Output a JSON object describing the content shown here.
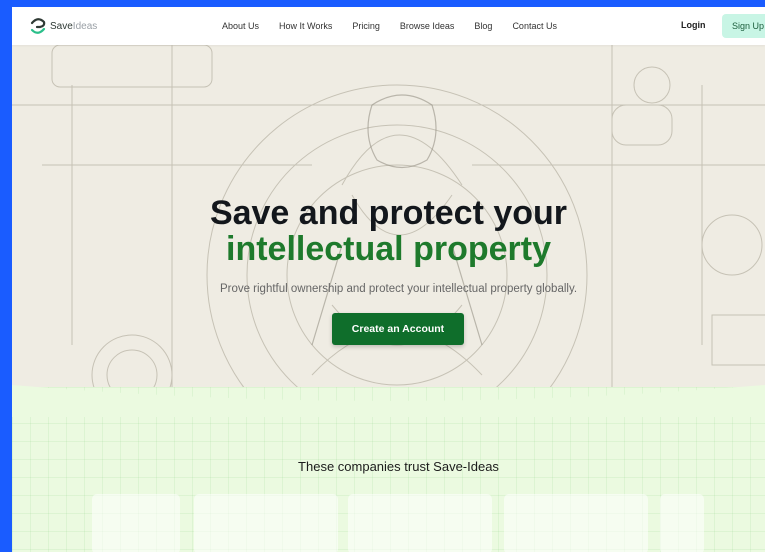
{
  "brand": {
    "name_bold": "Save",
    "name_light": "Ideas"
  },
  "nav": {
    "links": [
      "About Us",
      "How It Works",
      "Pricing",
      "Browse Ideas",
      "Blog",
      "Contact Us"
    ],
    "login": "Login",
    "signup": "Sign Up"
  },
  "hero": {
    "headline_line1": "Save and protect your",
    "headline_line2": "intellectual property",
    "subtitle": "Prove rightful ownership and protect your intellectual property globally.",
    "cta": "Create an Account"
  },
  "trust": {
    "title": "These companies trust Save-Ideas"
  },
  "colors": {
    "accent": "#1e7a2c",
    "cta_bg": "#0f6e2b",
    "signup_bg": "#c8f5e5",
    "frame": "#1a5cff"
  }
}
